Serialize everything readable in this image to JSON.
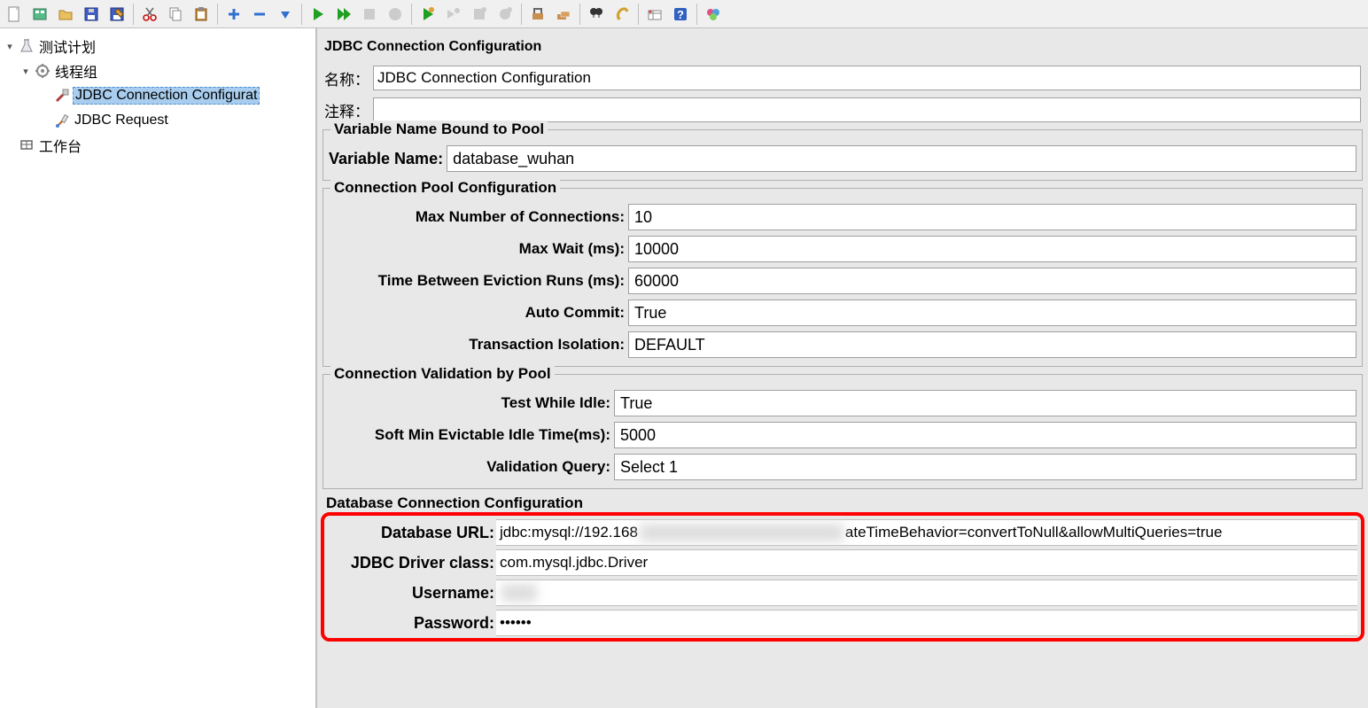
{
  "toolbar_icons": [
    "new-file-icon",
    "templates-icon",
    "open-icon",
    "save-icon",
    "save-as-icon",
    "sep",
    "cut-icon",
    "copy-icon",
    "paste-icon",
    "sep",
    "expand-icon",
    "collapse-icon",
    "toggle-icon",
    "sep",
    "start-icon",
    "start-no-pause-icon",
    "stop-icon",
    "shutdown-icon",
    "sep",
    "remote-start-icon",
    "remote-start-all-icon",
    "remote-stop-icon",
    "remote-shutdown-icon",
    "sep",
    "clear-icon",
    "clear-all-icon",
    "sep",
    "search-icon",
    "reset-search-icon",
    "sep",
    "function-helper-icon",
    "help-icon",
    "sep",
    "about-icon"
  ],
  "tree": {
    "root": "测试计划",
    "thread_group": "线程组",
    "jdbc_config": "JDBC Connection Configurat",
    "jdbc_request": "JDBC Request",
    "workbench": "工作台"
  },
  "panel": {
    "title": "JDBC Connection Configuration",
    "name_label": "名称：",
    "name_value": "JDBC Connection Configuration",
    "comment_label": "注释：",
    "comment_value": ""
  },
  "var_pool": {
    "group_title": "Variable Name Bound to Pool",
    "label": "Variable Name:",
    "value": "database_wuhan"
  },
  "conn_pool": {
    "group_title": "Connection Pool Configuration",
    "rows": [
      {
        "label": "Max Number of Connections:",
        "value": "10"
      },
      {
        "label": "Max Wait (ms):",
        "value": "10000"
      },
      {
        "label": "Time Between Eviction Runs (ms):",
        "value": "60000"
      },
      {
        "label": "Auto Commit:",
        "value": "True"
      },
      {
        "label": "Transaction Isolation:",
        "value": "DEFAULT"
      }
    ]
  },
  "validation": {
    "group_title": "Connection Validation by Pool",
    "rows": [
      {
        "label": "Test While Idle:",
        "value": "True"
      },
      {
        "label": "Soft Min Evictable Idle Time(ms):",
        "value": "5000"
      },
      {
        "label": "Validation Query:",
        "value": "Select 1"
      }
    ]
  },
  "db_conn": {
    "group_title": "Database Connection Configuration",
    "url_label": "Database URL:",
    "url_prefix": "jdbc:mysql://192.168",
    "url_suffix": "ateTimeBehavior=convertToNull&allowMultiQueries=true",
    "driver_label": "JDBC Driver class:",
    "driver_value": "com.mysql.jdbc.Driver",
    "user_label": "Username:",
    "user_value": "",
    "pass_label": "Password:",
    "pass_value": "••••••"
  }
}
